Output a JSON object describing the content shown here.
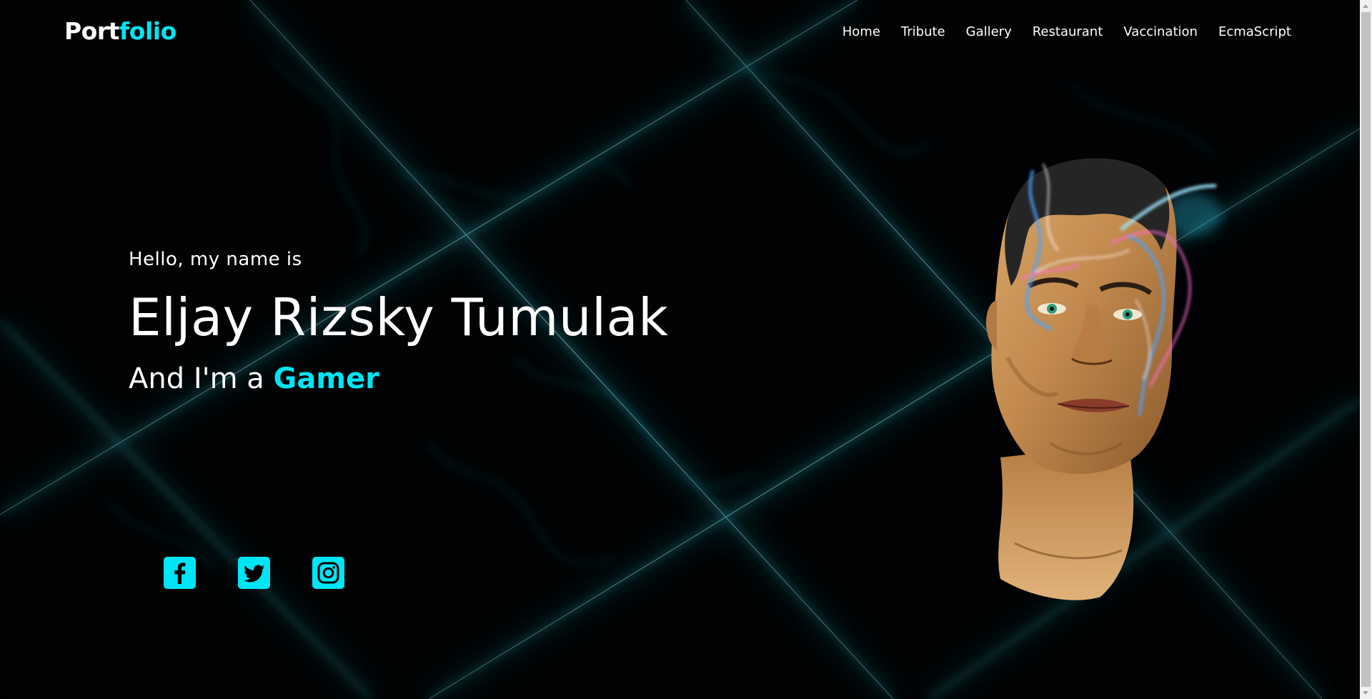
{
  "navbar": {
    "logo_part1": "Port",
    "logo_part2": "folio",
    "links": [
      "Home",
      "Tribute",
      "Gallery",
      "Restaurant",
      "Vaccination",
      "EcmaScript"
    ]
  },
  "hero": {
    "greeting": "Hello, my name is",
    "name": "Eljay Rizsky Tumulak",
    "role_prefix": "And I'm a",
    "role_highlight": "Gamer"
  },
  "social": {
    "icons": [
      "facebook-icon",
      "twitter-icon",
      "instagram-icon"
    ]
  },
  "colors": {
    "accent": "#00e5f5",
    "background": "#000000",
    "text": "#ffffff"
  }
}
